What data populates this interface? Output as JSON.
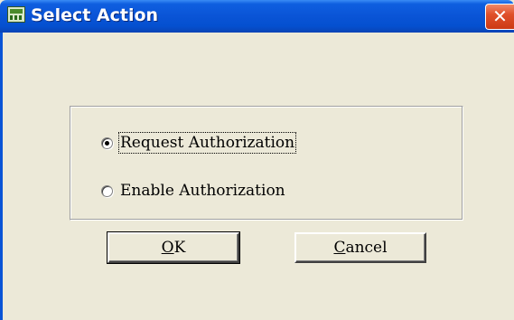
{
  "window": {
    "title": "Select Action",
    "close_glyph": "✕"
  },
  "options": {
    "items": [
      {
        "label": "Request Authorization",
        "checked": true
      },
      {
        "label": "Enable Authorization",
        "checked": false
      }
    ]
  },
  "buttons": {
    "ok": {
      "mnemonic": "O",
      "rest": "K"
    },
    "cancel": {
      "mnemonic": "C",
      "rest": "ancel"
    }
  },
  "colors": {
    "titlebar": "#0a54d6",
    "client": "#ece9d8",
    "close_button": "#e0502a"
  },
  "icons": {
    "title_icon": "app-window-icon",
    "close_icon": "close-icon"
  }
}
